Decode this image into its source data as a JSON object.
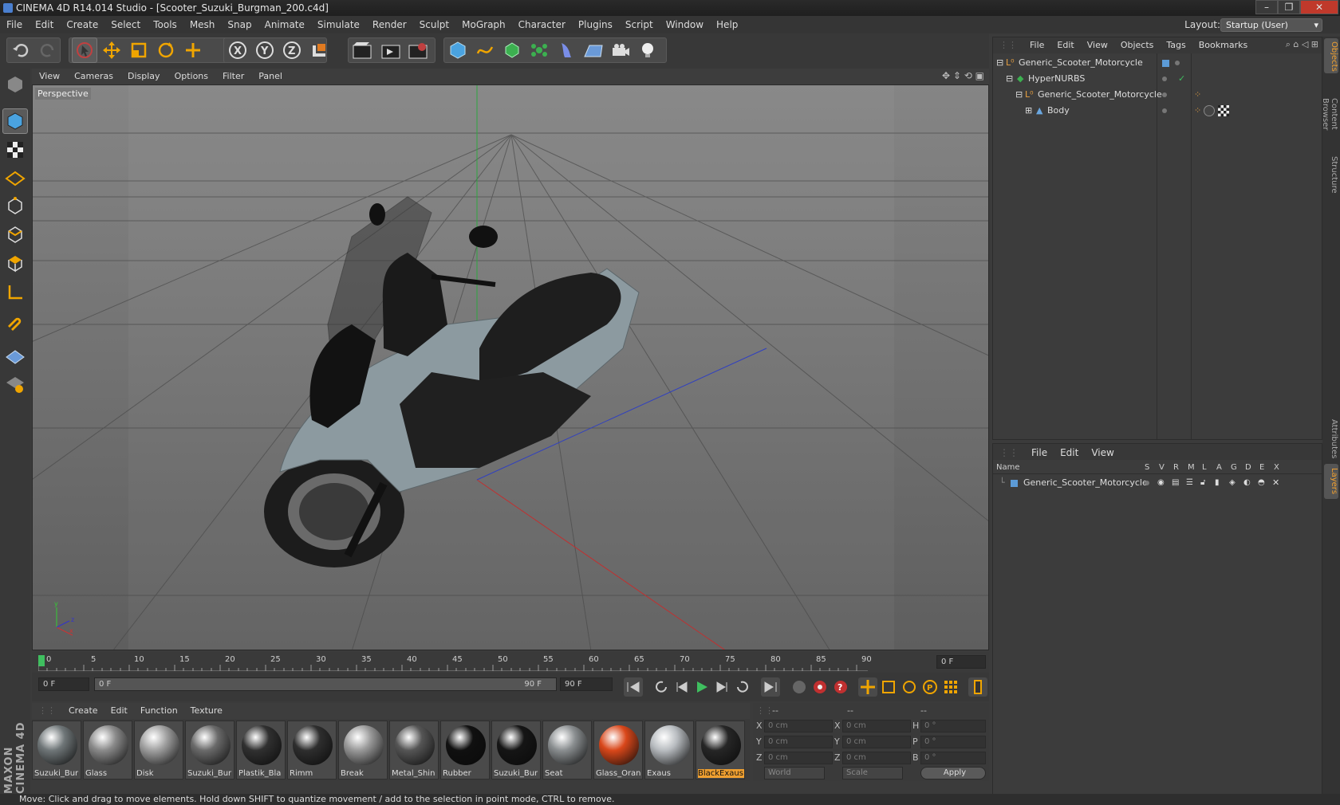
{
  "window": {
    "title": "CINEMA 4D R14.014 Studio - [Scooter_Suzuki_Burgman_200.c4d]",
    "buttons": [
      "–",
      "❐",
      "✕"
    ]
  },
  "menubar": {
    "items": [
      "File",
      "Edit",
      "Create",
      "Select",
      "Tools",
      "Mesh",
      "Snap",
      "Animate",
      "Simulate",
      "Render",
      "Sculpt",
      "MoGraph",
      "Character",
      "Plugins",
      "Script",
      "Window",
      "Help"
    ],
    "layout_label": "Layout:",
    "layout_value": "Startup (User)"
  },
  "toolbar": {
    "icons": [
      "undo-icon",
      "redo-icon",
      "live-selection-icon",
      "move-icon",
      "scale-icon",
      "rotate-icon",
      "add-icon",
      "x-axis-icon",
      "y-axis-icon",
      "z-axis-icon",
      "coordinate-system-icon",
      "render-view-icon",
      "render-picture-viewer-icon",
      "render-settings-icon",
      "cube-icon",
      "spline-icon",
      "nurbs-icon",
      "array-icon",
      "deformer-icon",
      "scene-icon",
      "camera-icon",
      "light-icon"
    ]
  },
  "viewport": {
    "menu": [
      "View",
      "Cameras",
      "Display",
      "Options",
      "Filter",
      "Panel"
    ],
    "label": "Perspective",
    "axis_x": "x",
    "axis_y": "y",
    "axis_z": "z"
  },
  "timeline": {
    "ticks": [
      "0",
      "5",
      "10",
      "15",
      "20",
      "25",
      "30",
      "35",
      "40",
      "45",
      "50",
      "55",
      "60",
      "65",
      "70",
      "75",
      "80",
      "85",
      "90"
    ],
    "current_frame": "0 F"
  },
  "transport": {
    "start_frame": "0 F",
    "range_start": "0 F",
    "range_end": "90 F",
    "end_frame": "90 F"
  },
  "materials": {
    "menu": [
      "Create",
      "Edit",
      "Function",
      "Texture"
    ],
    "items": [
      {
        "name": "Suzuki_Bur",
        "color": "#6f7678"
      },
      {
        "name": "Glass",
        "color": "#8a8a8a"
      },
      {
        "name": "Disk",
        "color": "#a0a0a0"
      },
      {
        "name": "Suzuki_Bur",
        "color": "#6a6a6a"
      },
      {
        "name": "Plastik_Bla",
        "color": "#303030"
      },
      {
        "name": "Rimm",
        "color": "#2e2e2e"
      },
      {
        "name": "Break",
        "color": "#999999"
      },
      {
        "name": "Metal_Shin",
        "color": "#555555"
      },
      {
        "name": "Rubber",
        "color": "#101010"
      },
      {
        "name": "Suzuki_Bur",
        "color": "#151515"
      },
      {
        "name": "Seat",
        "color": "#8a8e90"
      },
      {
        "name": "Glass_Oran",
        "color": "#d9471a"
      },
      {
        "name": "Exaus",
        "color": "#b8bcc0"
      },
      {
        "name": "BlackExaus",
        "color": "#262626"
      }
    ]
  },
  "coords": {
    "header": [
      "--",
      "--",
      "--"
    ],
    "rows": [
      {
        "l1": "X",
        "v1": "0 cm",
        "l2": "X",
        "v2": "0 cm",
        "l3": "H",
        "v3": "0 °"
      },
      {
        "l1": "Y",
        "v1": "0 cm",
        "l2": "Y",
        "v2": "0 cm",
        "l3": "P",
        "v3": "0 °"
      },
      {
        "l1": "Z",
        "v1": "0 cm",
        "l2": "Z",
        "v2": "0 cm",
        "l3": "B",
        "v3": "0 °"
      }
    ],
    "world": "World",
    "scale": "Scale",
    "apply": "Apply"
  },
  "object_manager": {
    "menu": [
      "File",
      "Edit",
      "View",
      "Objects",
      "Tags",
      "Bookmarks"
    ],
    "items": [
      {
        "name": "Generic_Scooter_Motorcycle",
        "depth": 0
      },
      {
        "name": "HyperNURBS",
        "depth": 1
      },
      {
        "name": "Generic_Scooter_Motorcycle",
        "depth": 2
      },
      {
        "name": "Body",
        "depth": 3
      }
    ]
  },
  "layer_manager": {
    "menu": [
      "File",
      "Edit",
      "View"
    ],
    "columns": [
      "Name",
      "S",
      "V",
      "R",
      "M",
      "L",
      "A",
      "G",
      "D",
      "E",
      "X"
    ],
    "layer_name": "Generic_Scooter_Motorcycle",
    "layer_color": "#5c9bd6"
  },
  "side_tabs": [
    "Objects",
    "Content Browser",
    "Structure",
    "Attributes",
    "Layers"
  ],
  "brand": "MAXON CINEMA 4D",
  "status": "Move: Click and drag to move elements. Hold down SHIFT to quantize movement / add to the selection in point mode, CTRL to remove."
}
